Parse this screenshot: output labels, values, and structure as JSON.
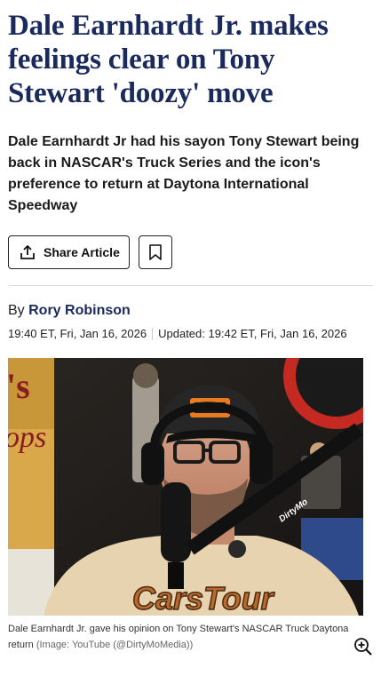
{
  "article": {
    "headline": "Dale Earnhardt Jr. makes feelings clear on Tony Stewart 'doozy' move",
    "standfirst": "Dale Earnhardt Jr had his sayon Tony Stewart being back in NASCAR's Truck Series and the icon's preference to return at Daytona International Speedway",
    "share_label": "Share Article",
    "byline_prefix": "By",
    "author": "Rory Robinson",
    "published": "19:40 ET, Fri, Jan 16, 2026",
    "updated": "Updated: 19:42 ET, Fri, Jan 16, 2026"
  },
  "image": {
    "shirt_text": "CarsTour",
    "mic_arm_text": "DirtyMo",
    "banner_text": "'s",
    "banner_text2": "ops",
    "caption": "Dale Earnhardt Jr. gave his opinion on Tony Stewart's NASCAR Truck Daytona return",
    "credit": "(Image: YouTube (@DirtyMoMedia))"
  },
  "icons": {
    "share": "share-icon",
    "bookmark": "bookmark-icon",
    "zoom": "zoom-in-icon"
  },
  "colors": {
    "headline": "#1b2a5c",
    "author": "#1b2a5c"
  }
}
